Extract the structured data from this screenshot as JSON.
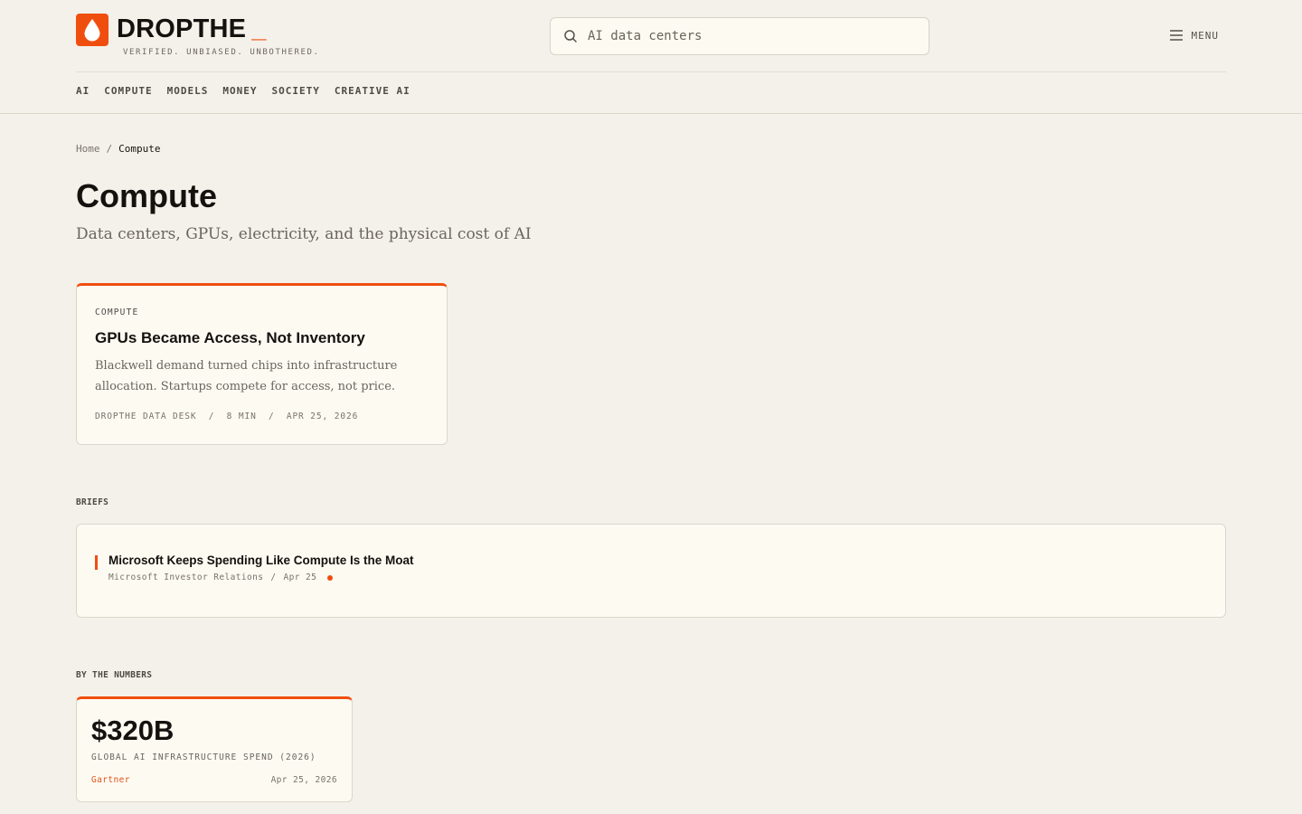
{
  "header": {
    "logo_word": "DROPTHE",
    "logo_cursor": "_",
    "tagline": "VERIFIED. UNBIASED. UNBOTHERED.",
    "search": {
      "placeholder": "AI data centers"
    },
    "menu_label": "MENU"
  },
  "nav": {
    "items": [
      {
        "label": "AI"
      },
      {
        "label": "COMPUTE"
      },
      {
        "label": "MODELS"
      },
      {
        "label": "MONEY"
      },
      {
        "label": "SOCIETY"
      },
      {
        "label": "CREATIVE AI"
      }
    ]
  },
  "breadcrumb": {
    "home": "Home",
    "separator": "/",
    "current": "Compute"
  },
  "page": {
    "title": "Compute",
    "subtitle": "Data centers, GPUs, electricity, and the physical cost of AI"
  },
  "feature": {
    "kicker": "COMPUTE",
    "headline": "GPUs Became Access, Not Inventory",
    "dek": "Blackwell demand turned chips into infrastructure allocation. Startups compete for access, not price.",
    "meta": "DROPTHE DATA DESK  /  8 MIN  /  APR 25, 2026"
  },
  "briefs": {
    "label": "BRIEFS",
    "items": [
      {
        "title": "Microsoft Keeps Spending Like Compute Is the Moat",
        "source": "Microsoft Investor Relations",
        "separator": "/",
        "date": "Apr 25"
      }
    ]
  },
  "numbers": {
    "label": "BY THE NUMBERS",
    "items": [
      {
        "value": "$320B",
        "label": "GLOBAL AI INFRASTRUCTURE SPEND (2026)",
        "source": "Gartner",
        "date": "Apr 25, 2026"
      }
    ]
  },
  "colors": {
    "accent": "#f04e0f",
    "background": "#f4f1ea",
    "card": "#fdfaf2",
    "text": "#14110f"
  }
}
